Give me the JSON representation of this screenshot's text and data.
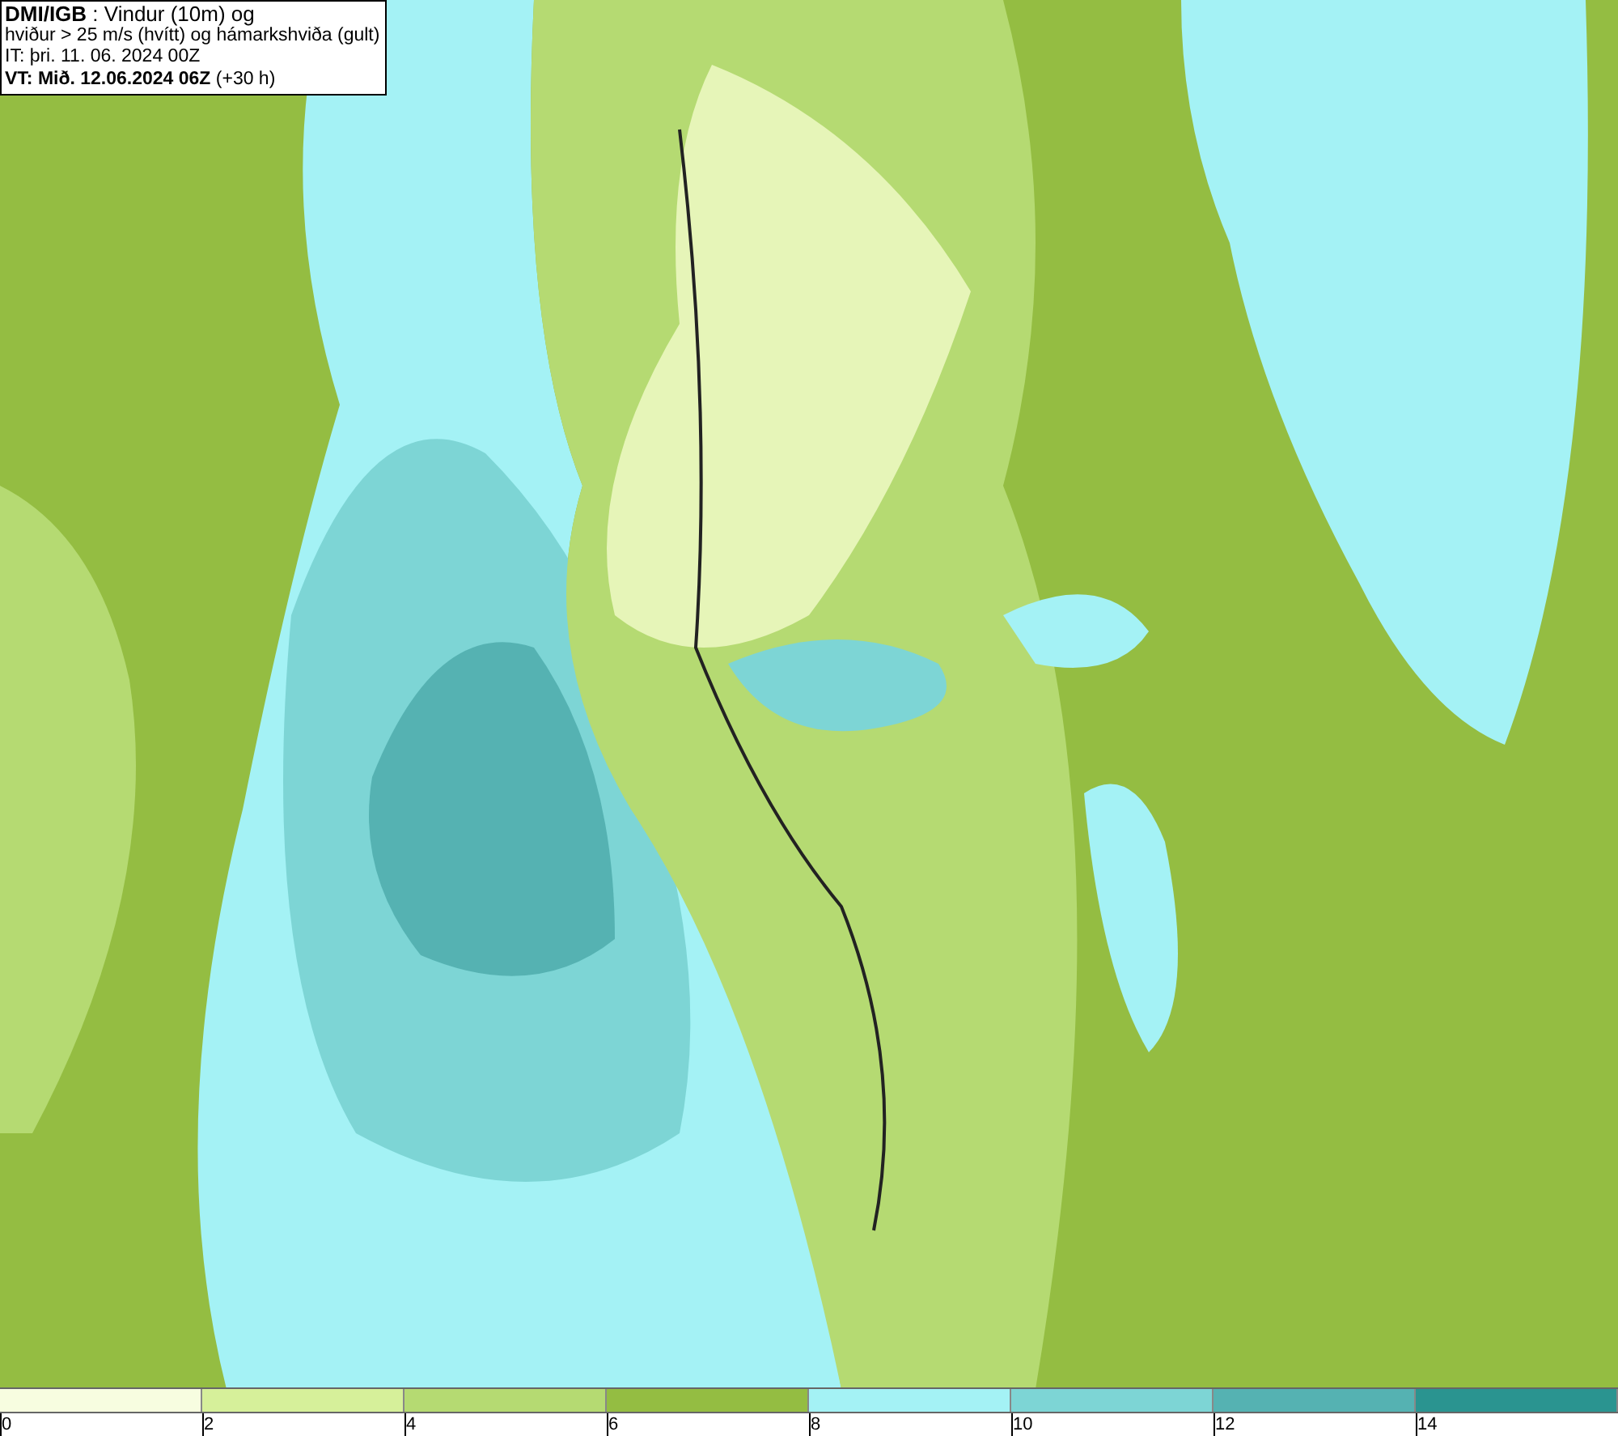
{
  "info": {
    "lines": [
      "**DMI/IGB** : Vindur (10m) og",
      "hviður > 25 m/s (hvítt) og hámarkshviða (gult)",
      "IT: þri. 11. 06. 2024 00Z",
      "**VT: Mið. 12.06.2024 06Z** (+30 h)"
    ]
  },
  "legend": {
    "segments": [
      {
        "color": "#f7fde0"
      },
      {
        "color": "#d6f09a"
      },
      {
        "color": "#b5da72"
      },
      {
        "color": "#94bd42"
      },
      {
        "color": "#a4f2f5"
      },
      {
        "color": "#7dd5d5"
      },
      {
        "color": "#55b2b2"
      },
      {
        "color": "#2a9490"
      }
    ],
    "ticks": [
      "0",
      "2",
      "4",
      "6",
      "8",
      "10",
      "12",
      "14"
    ]
  }
}
